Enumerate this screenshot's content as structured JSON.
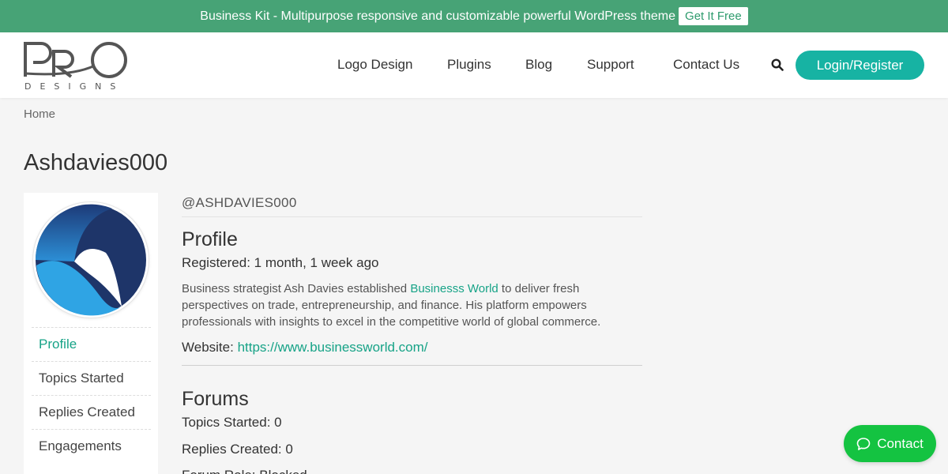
{
  "promo": {
    "text": "Business Kit - Multipurpose responsive and customizable powerful WordPress theme",
    "button": "Get It Free"
  },
  "logo": {
    "word": "PRO",
    "tagline": "DESIGNS"
  },
  "nav": {
    "items": [
      "Logo Design",
      "Plugins",
      "Blog",
      "Support",
      "Contact Us"
    ],
    "search_icon": "search-icon",
    "login": "Login/Register"
  },
  "breadcrumb": {
    "home": "Home"
  },
  "page": {
    "title": "Ashdavies000"
  },
  "sidebar": {
    "menu": [
      "Profile",
      "Topics Started",
      "Replies Created",
      "Engagements"
    ],
    "active": "Profile"
  },
  "profile": {
    "handle": "@ASHDAVIES000",
    "heading": "Profile",
    "registered": "Registered: 1 month, 1 week ago",
    "bio_before": "Business strategist Ash Davies established ",
    "bio_link": "Businesss World",
    "bio_after": " to deliver fresh perspectives on trade, entrepreneurship, and finance. His platform empowers professionals with insights to excel in the competitive world of global commerce.",
    "website_label": "Website: ",
    "website_url": "https://www.businessworld.com/"
  },
  "forums": {
    "heading": "Forums",
    "topics_started": "Topics Started: 0",
    "replies_created": "Replies Created: 0",
    "forum_role": "Forum Role: Blocked"
  },
  "contact_widget": {
    "label": "Contact"
  },
  "colors": {
    "promo_bar": "#47a376",
    "accent": "#17a387",
    "login_button": "#17b3a3",
    "contact_button": "#14c341"
  }
}
